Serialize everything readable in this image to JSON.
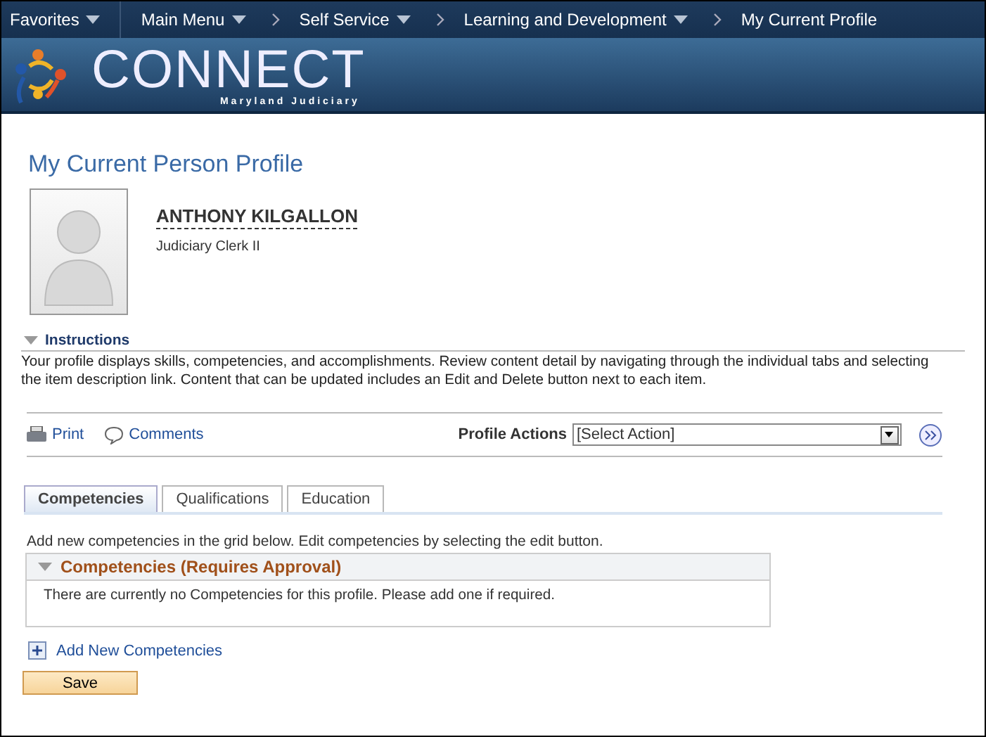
{
  "nav": {
    "favorites": {
      "label": "Favorites",
      "dropdown": true
    },
    "crumbs": [
      {
        "label": "Main Menu",
        "dropdown": true
      },
      {
        "label": "Self Service",
        "dropdown": true
      },
      {
        "label": "Learning and Development",
        "dropdown": true
      },
      {
        "label": "My Current Profile",
        "dropdown": false
      }
    ]
  },
  "banner": {
    "logo": "CONNECT",
    "subtitle": "Maryland Judiciary"
  },
  "page_title": "My Current Person Profile",
  "person": {
    "name": "ANTHONY KILGALLON",
    "job_title": "Judiciary Clerk II"
  },
  "instructions": {
    "title": "Instructions",
    "expanded": true,
    "text": "Your profile displays skills, competencies, and accomplishments. Review content detail by navigating through the individual tabs and selecting the item description link. Content that can be updated includes an Edit and Delete button next to each item."
  },
  "toolbar": {
    "print": "Print",
    "comments": "Comments",
    "actions_label": "Profile Actions",
    "actions_value": "[Select Action]"
  },
  "tabs": [
    {
      "label": "Competencies",
      "selected": true
    },
    {
      "label": "Qualifications",
      "selected": false
    },
    {
      "label": "Education",
      "selected": false
    }
  ],
  "tab_intro": "Add new competencies in the grid below. Edit competencies by selecting the edit button.",
  "grid": {
    "title": "Competencies (Requires Approval)",
    "expanded": true,
    "empty_message": "There are currently no Competencies for this profile.  Please add one if required."
  },
  "add_link": "Add New Competencies",
  "save_button": "Save"
}
